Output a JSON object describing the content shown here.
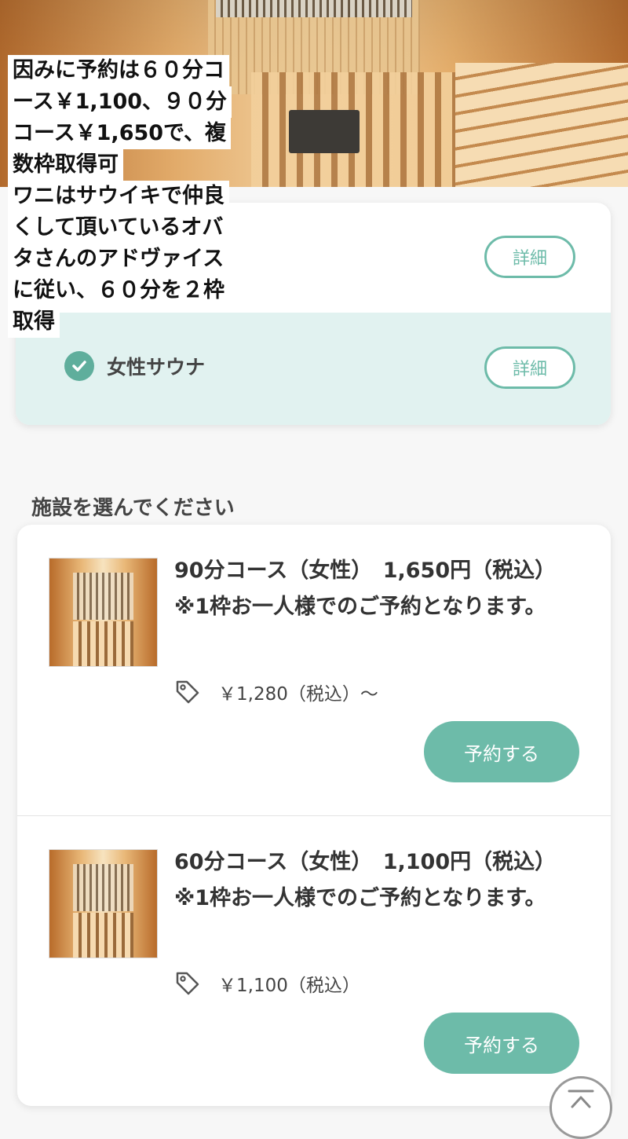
{
  "overlay_caption": {
    "lines": [
      "因みに予約は６０分コ",
      "ース￥1,100、９０分",
      "コース￥1,650で、複",
      "数枠取得可",
      "ワニはサウイキで仲良",
      "くして頂いているオバ",
      "タさんのアドヴァイス",
      "に従い、６０分を２枠",
      "取得"
    ]
  },
  "category_card": {
    "detail_button_1": "詳細",
    "female_sauna_label": "女性サウナ",
    "detail_button_2": "詳細"
  },
  "section_title": "施設を選んでください",
  "plans": [
    {
      "title": "90分コース（女性）　1,650円（税込）　※1枠お一人様でのご予約となります。",
      "price": "￥1,280（税込）〜",
      "reserve_label": "予約する"
    },
    {
      "title": "60分コース（女性）　1,100円（税込）　※1枠お一人様でのご予約となります。",
      "price": "￥1,100（税込）",
      "reserve_label": "予約する"
    }
  ],
  "colors": {
    "accent": "#6dbba9",
    "selected_row": "#e1f2f0"
  },
  "icons": [
    "check-circle-icon",
    "price-tag-icon",
    "back-to-top-icon"
  ]
}
